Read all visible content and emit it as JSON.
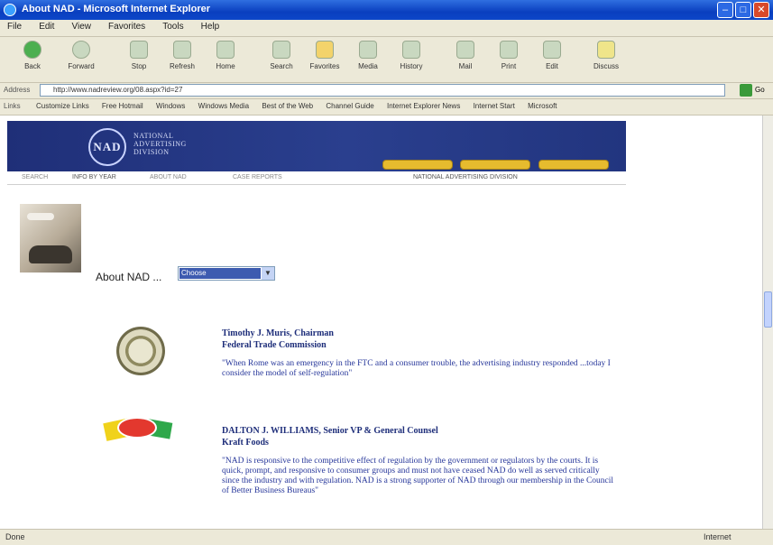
{
  "window": {
    "title": "About NAD - Microsoft Internet Explorer"
  },
  "menu": [
    "File",
    "Edit",
    "View",
    "Favorites",
    "Tools",
    "Help"
  ],
  "toolbar": [
    "Back",
    "Forward",
    "Stop",
    "Refresh",
    "Home",
    "Search",
    "Favorites",
    "Media",
    "History",
    "Mail",
    "Print",
    "Edit",
    "Discuss"
  ],
  "address": {
    "label": "Address",
    "url": "http://www.nadreview.org/08.aspx?id=27",
    "go": "Go"
  },
  "links": {
    "label": "Links",
    "items": [
      "Customize Links",
      "Free Hotmail",
      "Windows",
      "Windows Media",
      "Best of the Web",
      "Channel Guide",
      "Internet Explorer News",
      "Internet Start",
      "Microsoft"
    ]
  },
  "site": {
    "logo_initials": "NAD",
    "logo_text": [
      "NATIONAL",
      "ADVERTISING",
      "DIVISION"
    ],
    "subnav": [
      "SEARCH",
      "INFO BY YEAR",
      "ABOUT NAD",
      "CASE REPORTS"
    ],
    "section": "NATIONAL ADVERTISING DIVISION"
  },
  "about": {
    "label": "About NAD ...",
    "select_value": "Choose"
  },
  "quotes": [
    {
      "name": "Timothy J. Muris, Chairman",
      "org": "Federal Trade Commission",
      "text": "\"When Rome was an emergency in the FTC and a consumer trouble, the advertising industry responded ...today I consider the model of self-regulation\""
    },
    {
      "name": "DALTON J. WILLIAMS, Senior VP & General Counsel",
      "org": "Kraft Foods",
      "text": "\"NAD is responsive to the competitive effect of regulation by the government or regulators by the courts. It is quick, prompt, and responsive to consumer groups and must not have ceased NAD do well as served critically since the industry and with regulation. NAD is a strong supporter of NAD through our membership in the Council of Better Business Bureaus\""
    }
  ],
  "status": {
    "left": "Done",
    "right": "Internet"
  }
}
